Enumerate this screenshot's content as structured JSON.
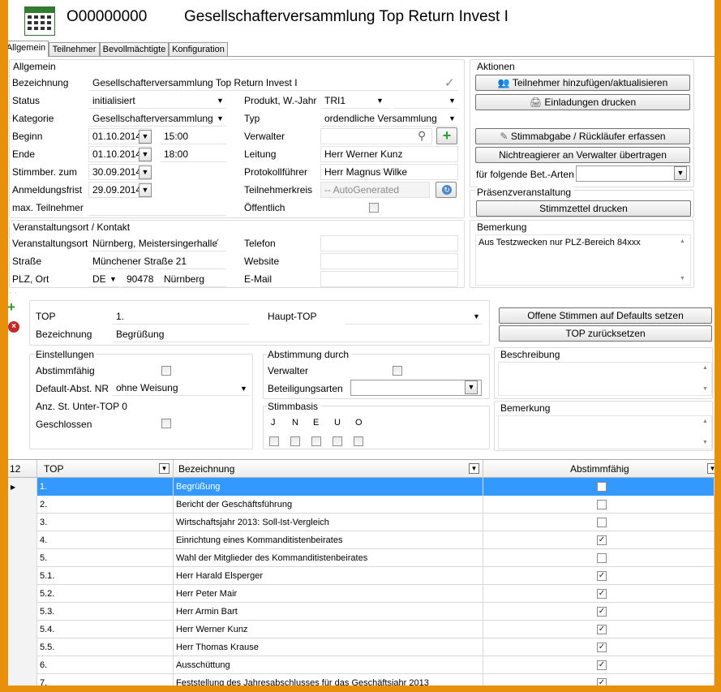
{
  "header": {
    "id": "O00000000",
    "title": "Gesellschafterversammlung Top Return Invest I"
  },
  "tabs": [
    "Allgemein",
    "Teilnehmer",
    "Bevollmächtigte",
    "Konfiguration"
  ],
  "allgemein": {
    "section_title": "Allgemein",
    "bezeichnung_label": "Bezeichnung",
    "bezeichnung_value": "Gesellschafterversammlung Top Return Invest I",
    "status_label": "Status",
    "status_value": "initialisiert",
    "produkt_label": "Produkt, W.-Jahr",
    "produkt_value": "TRI1",
    "jahr_value": "",
    "kategorie_label": "Kategorie",
    "kategorie_value": "Gesellschafterversammlung",
    "typ_label": "Typ",
    "typ_value": "ordendliche Versammlung",
    "beginn_label": "Beginn",
    "beginn_date": "01.10.2014",
    "beginn_time": "15:00",
    "verwalter_label": "Verwalter",
    "verwalter_value": "",
    "ende_label": "Ende",
    "ende_date": "01.10.2014",
    "ende_time": "18:00",
    "leitung_label": "Leitung",
    "leitung_value": "Herr Werner Kunz",
    "stimmber_label": "Stimmber. zum",
    "stimmber_value": "30.09.2014",
    "protokoll_label": "Protokollführer",
    "protokoll_value": "Herr Magnus Wilke",
    "anmeldefrist_label": "Anmeldungsfrist",
    "anmeldefrist_value": "29.09.2014",
    "teilnehmerkreis_label": "Teilnehmerkreis",
    "teilnehmerkreis_value": "-- AutoGenerated",
    "max_label": "max. Teilnehmer",
    "max_value": "",
    "oeffentlich_label": "Öffentlich"
  },
  "ort": {
    "section_title": "Veranstaltungsort / Kontakt",
    "veranstaltungsort_label": "Veranstaltungsort",
    "veranstaltungsort_value": "Nürnberg, Meistersingerhalle",
    "telefon_label": "Telefon",
    "telefon_value": "",
    "strasse_label": "Straße",
    "strasse_value": "Münchener Straße 21",
    "website_label": "Website",
    "website_value": "",
    "plz_label": "PLZ, Ort",
    "land_value": "DE",
    "plz_value": "90478",
    "ort_value": "Nürnberg",
    "email_label": "E-Mail",
    "email_value": ""
  },
  "aktionen": {
    "section_title": "Aktionen",
    "btn_teilnehmer": "Teilnehmer hinzufügen/aktualisieren",
    "btn_einladungen": "Einladungen drucken",
    "btn_stimmabgabe": "Stimmabgabe / Rückläufer erfassen",
    "btn_nichtreagierer": "Nichtreagierer an Verwalter übertragen",
    "bet_arten_label": "für folgende Bet.-Arten",
    "bet_arten_value": ""
  },
  "praesenz": {
    "section_title": "Präsenzveranstaltung",
    "btn_stimmzettel": "Stimmzettel drucken"
  },
  "bemerkung": {
    "section_title": "Bemerkung",
    "value": "Aus Testzwecken nur PLZ-Bereich 84xxx"
  },
  "top": {
    "top_label": "TOP",
    "top_value": "1.",
    "haupt_label": "Haupt-TOP",
    "haupt_value": "",
    "bezeichnung_label": "Bezeichnung",
    "bezeichnung_value": "Begrüßung",
    "btn_offene": "Offene Stimmen auf Defaults setzen",
    "btn_reset": "TOP zurücksetzen",
    "einstellungen_title": "Einstellungen",
    "abstimmfaehig_label": "Abstimmfähig",
    "default_label": "Default-Abst. NR",
    "default_value": "ohne Weisung",
    "anz_label": "Anz. St. Unter-TOP",
    "anz_value": "0",
    "geschlossen_label": "Geschlossen",
    "abstimmung_title": "Abstimmung durch",
    "verwalter_label": "Verwalter",
    "beteiligung_label": "Beteiligungsarten",
    "beteiligung_value": "",
    "stimmbasis_title": "Stimmbasis",
    "stimmbasis_letters": [
      "J",
      "N",
      "E",
      "U",
      "O"
    ],
    "beschreibung_title": "Beschreibung",
    "bemerkung_title": "Bemerkung"
  },
  "grid": {
    "count": "12",
    "col_top": "TOP",
    "col_bezeichnung": "Bezeichnung",
    "col_abstimmfaehig": "Abstimmfähig",
    "rows": [
      {
        "top": "1.",
        "bezeichnung": "Begrüßung",
        "abstimmfaehig": false
      },
      {
        "top": "2.",
        "bezeichnung": "Bericht der Geschäftsführung",
        "abstimmfaehig": false
      },
      {
        "top": "3.",
        "bezeichnung": "Wirtschaftsjahr 2013: Soll-Ist-Vergleich",
        "abstimmfaehig": false
      },
      {
        "top": "4.",
        "bezeichnung": "Einrichtung eines Kommanditistenbeirates",
        "abstimmfaehig": true
      },
      {
        "top": "5.",
        "bezeichnung": "Wahl der Mitglieder des Kommanditistenbeirates",
        "abstimmfaehig": false
      },
      {
        "top": "5.1.",
        "bezeichnung": "Herr Harald Elsperger",
        "abstimmfaehig": true
      },
      {
        "top": "5.2.",
        "bezeichnung": "Herr Peter Mair",
        "abstimmfaehig": true
      },
      {
        "top": "5.3.",
        "bezeichnung": "Herr Armin Bart",
        "abstimmfaehig": true
      },
      {
        "top": "5.4.",
        "bezeichnung": "Herr Werner Kunz",
        "abstimmfaehig": true
      },
      {
        "top": "5.5.",
        "bezeichnung": "Herr Thomas Krause",
        "abstimmfaehig": true
      },
      {
        "top": "6.",
        "bezeichnung": "Ausschüttung",
        "abstimmfaehig": true
      },
      {
        "top": "7.",
        "bezeichnung": "Feststellung des Jahresabschlusses für das Geschäftsjahr 2013",
        "abstimmfaehig": true
      }
    ]
  },
  "colors": {
    "accent": "#3399ff",
    "frame": "#e8900a",
    "add_green": "#2e9b2e",
    "delete_red": "#c62828"
  }
}
